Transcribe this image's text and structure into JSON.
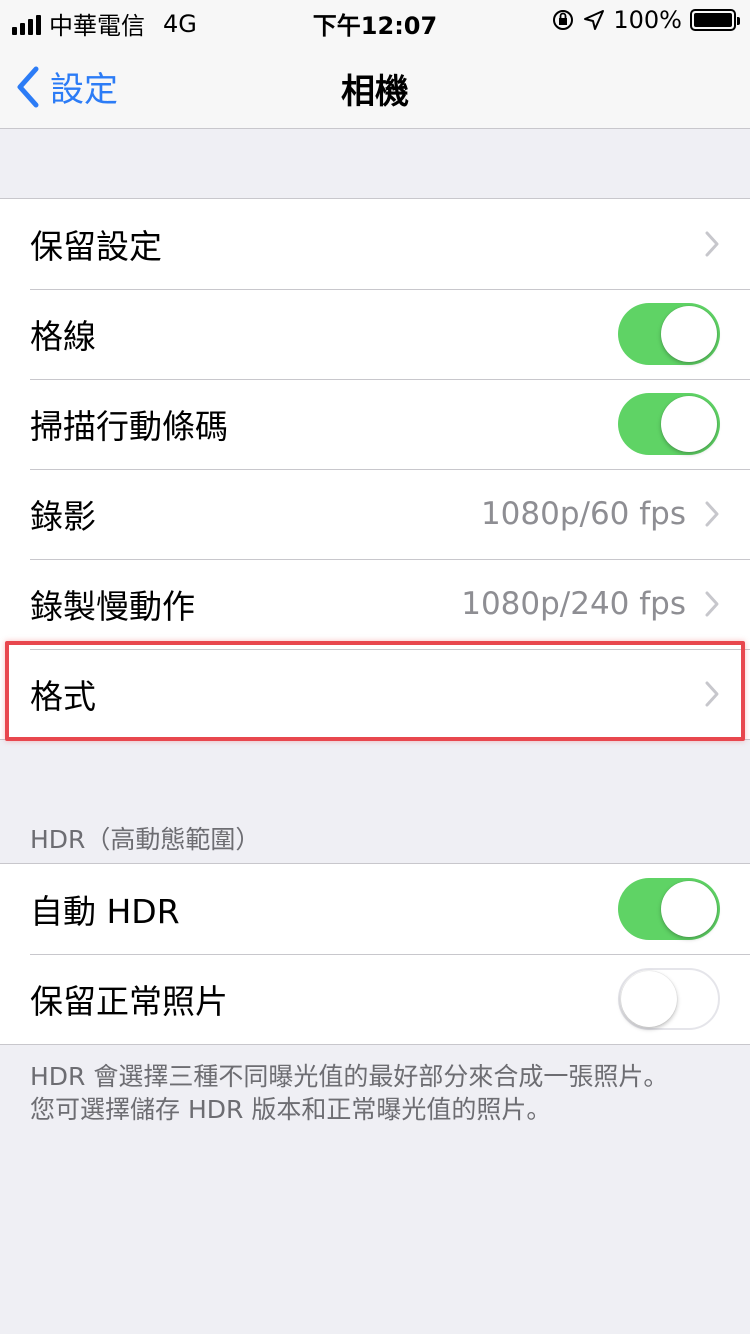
{
  "status_bar": {
    "carrier": "中華電信",
    "network": "4G",
    "time": "下午12:07",
    "battery": "100%"
  },
  "nav": {
    "back_label": "設定",
    "title": "相機"
  },
  "group1": {
    "rows": [
      {
        "label": "保留設定"
      },
      {
        "label": "格線"
      },
      {
        "label": "掃描行動條碼"
      },
      {
        "label": "錄影",
        "value": "1080p/60 fps"
      },
      {
        "label": "錄製慢動作",
        "value": "1080p/240 fps"
      },
      {
        "label": "格式"
      }
    ]
  },
  "hdr": {
    "header": "HDR（高動態範圍）",
    "rows": [
      {
        "label": "自動 HDR"
      },
      {
        "label": "保留正常照片"
      }
    ],
    "footer_line1": "HDR 會選擇三種不同曝光值的最好部分來合成一張照片。",
    "footer_line2": "您可選擇儲存 HDR 版本和正常曝光值的照片。"
  },
  "colors": {
    "accent": "#2c7cf6",
    "toggle_on": "#5fd365",
    "highlight": "#e8474e"
  }
}
